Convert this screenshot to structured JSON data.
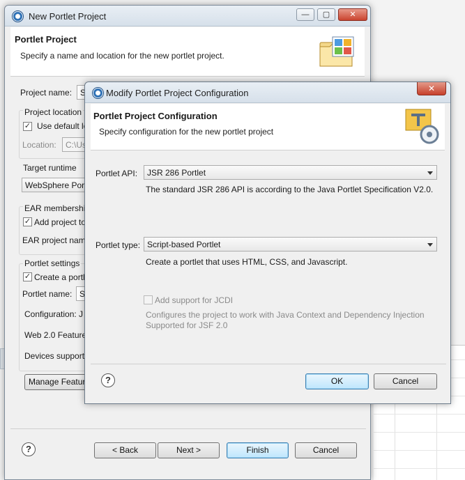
{
  "background_window": {
    "title": "New Portlet Project",
    "header_title": "Portlet Project",
    "header_subtitle": "Specify a name and location for the new portlet project.",
    "project_name_label": "Project name:",
    "project_name_value": "S",
    "project_location_label": "Project location",
    "use_default_label": "Use default lo",
    "location_label": "Location:",
    "location_value": "C:\\Us",
    "target_runtime_label": "Target runtime",
    "target_runtime_value": "WebSphere Port",
    "ear_membership_label": "EAR membership",
    "add_project_label": "Add project to",
    "ear_project_name_label": "EAR project nam",
    "portlet_settings_label": "Portlet settings",
    "create_portlet_label": "Create a portl",
    "portlet_name_label": "Portlet name:",
    "portlet_name_value": "S",
    "configuration_label": "Configuration: J",
    "web20_label": "Web 2.0 Feature",
    "devices_label": "Devices support",
    "manage_features_label": "Manage Featur",
    "back_label": "< Back",
    "next_label": "Next >",
    "finish_label": "Finish",
    "cancel_label": "Cancel",
    "help_glyph": "?",
    "ctl_min": "—",
    "ctl_max": "▢",
    "ctl_close": "✕"
  },
  "dialog": {
    "title": "Modify Portlet Project Configuration",
    "header_title": "Portlet Project Configuration",
    "header_subtitle": "Specify configuration for the new portlet project",
    "portlet_api_label": "Portlet API:",
    "portlet_api_value": "JSR 286 Portlet",
    "portlet_api_desc": "The standard JSR 286 API is according to the Java Portlet Specification V2.0.",
    "portlet_type_label": "Portlet type:",
    "portlet_type_value": "Script-based Portlet",
    "portlet_type_desc": "Create a portlet that uses HTML, CSS, and Javascript.",
    "jcdi_label": "Add support for JCDI",
    "jcdi_desc_line1": "Configures the project to work with Java Context and Dependency Injection",
    "jcdi_desc_line2": "Supported for JSF 2.0",
    "ok_label": "OK",
    "cancel_label": "Cancel",
    "help_glyph": "?",
    "close_glyph": "✕"
  },
  "checkbox_glyph": "✓"
}
